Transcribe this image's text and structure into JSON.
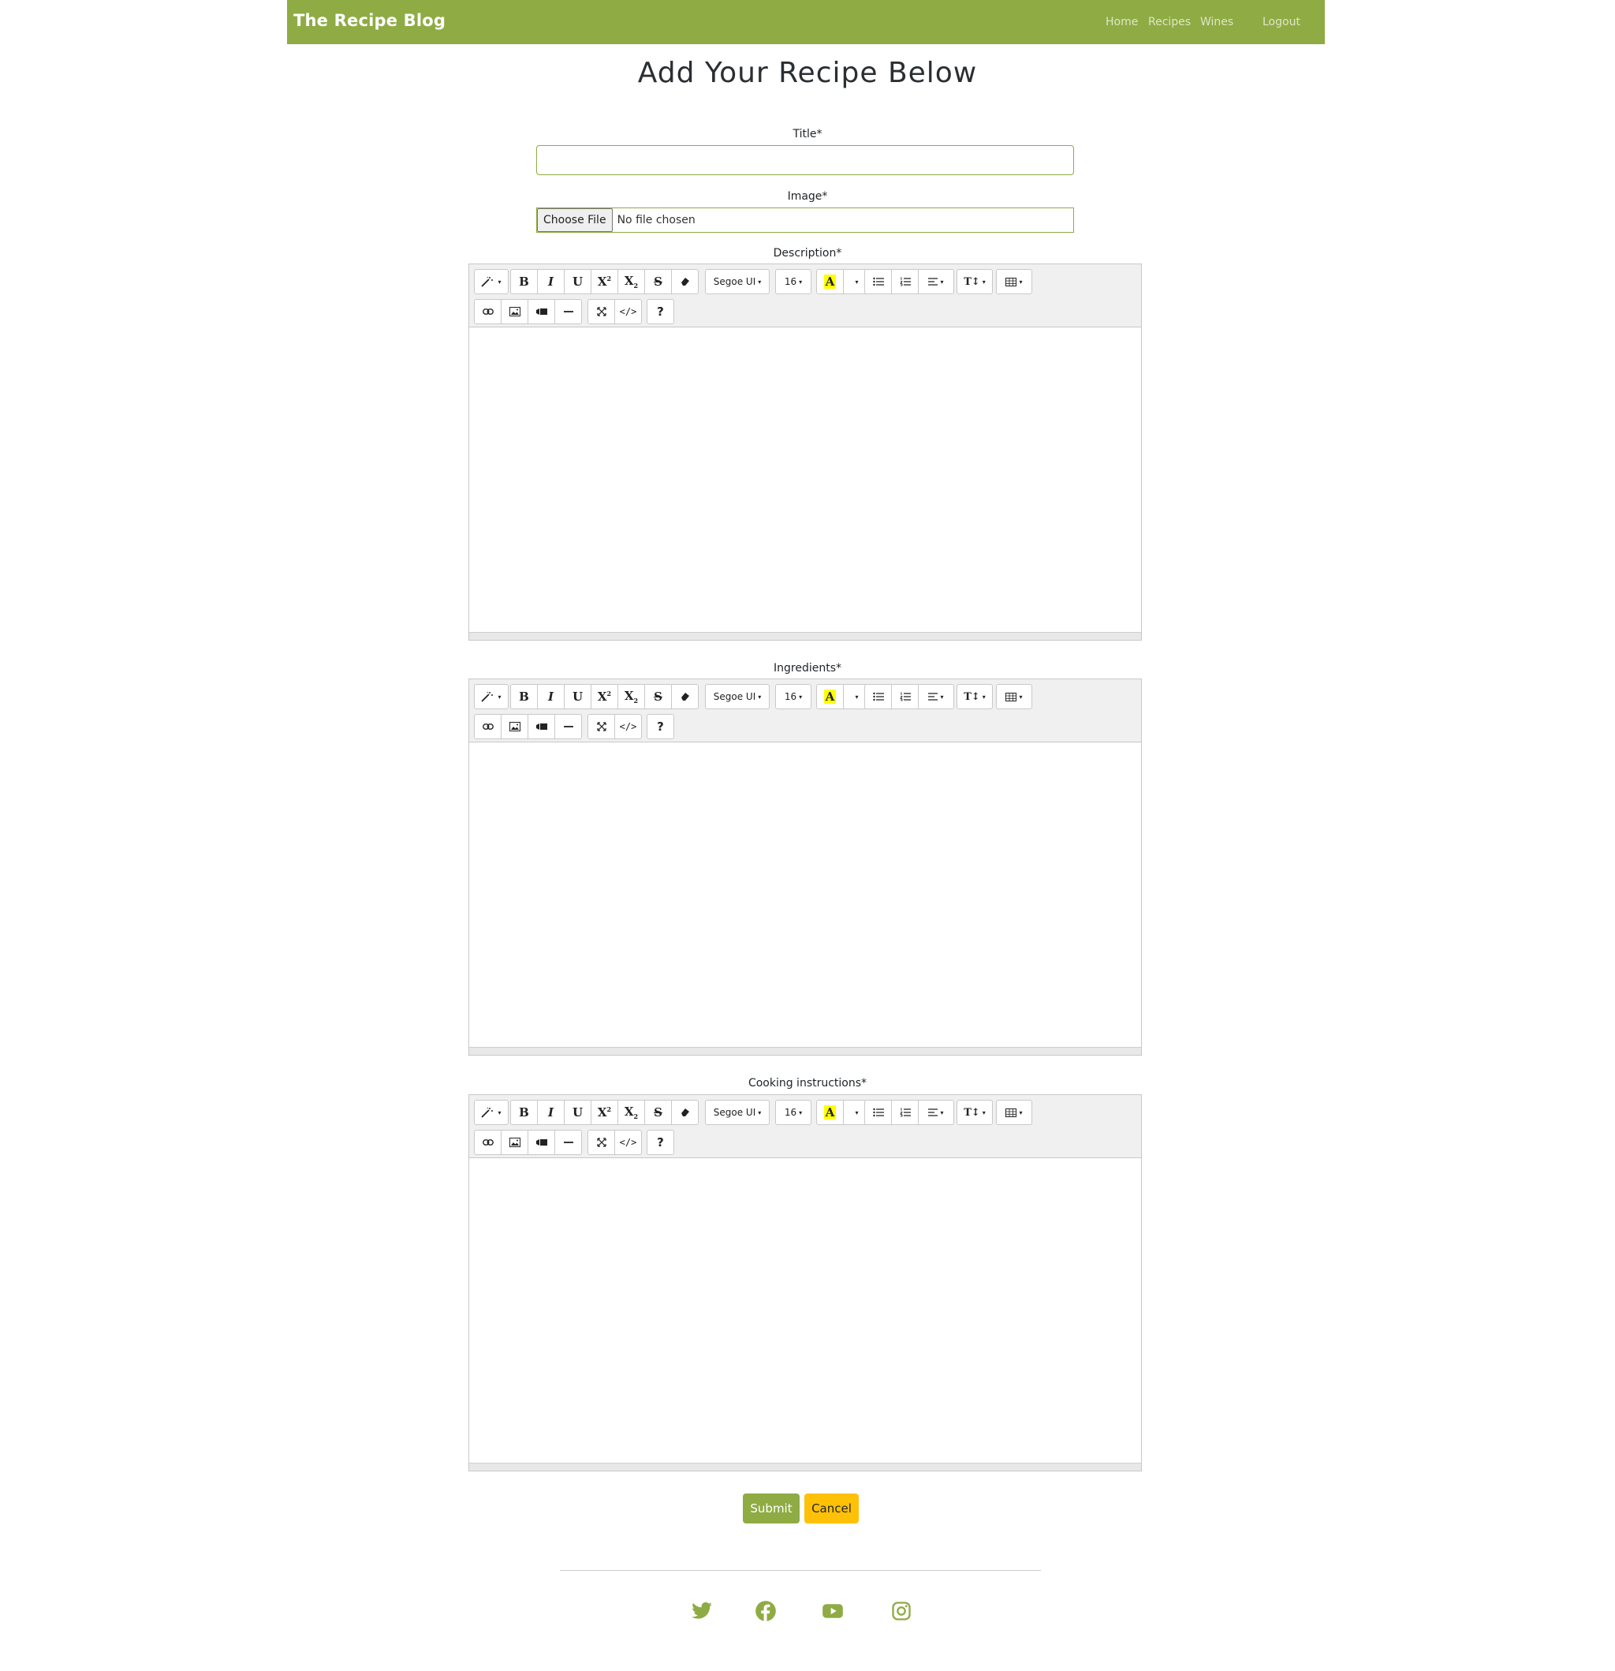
{
  "navbar": {
    "brand": "The Recipe Blog",
    "links": {
      "home": "Home",
      "recipes": "Recipes",
      "wines": "Wines",
      "logout": "Logout"
    },
    "color": "#8fab44"
  },
  "page": {
    "title": "Add Your Recipe Below"
  },
  "form": {
    "title_label": "Title*",
    "title_value": "",
    "image_label": "Image*",
    "file_button": "Choose File",
    "file_status": "No file chosen",
    "description_label": "Description*",
    "ingredients_label": "Ingredients*",
    "instructions_label": "Cooking instructions*"
  },
  "toolbar": {
    "font_name": "Segoe UI",
    "font_size": "16",
    "buttons_row1": [
      "magic-wand",
      "bold",
      "italic",
      "underline",
      "superscript",
      "subscript",
      "strikethrough",
      "eraser",
      "font-family",
      "font-size",
      "highlight-color",
      "color-dropdown",
      "unordered-list",
      "ordered-list",
      "paragraph-align",
      "line-height",
      "table"
    ],
    "buttons_row2": [
      "link",
      "picture",
      "video",
      "horizontal-rule",
      "fullscreen",
      "code-view",
      "help"
    ],
    "glyphs": {
      "bold": "B",
      "italic": "I",
      "underline": "U",
      "superscript": "X",
      "subscript": "X",
      "highlight": "A",
      "help": "?",
      "code": "</>"
    }
  },
  "actions": {
    "submit": "Submit",
    "cancel": "Cancel",
    "submit_color": "#8fab44",
    "cancel_color": "#ffc107"
  },
  "footer": {
    "icons": [
      "twitter-icon",
      "facebook-icon",
      "youtube-icon",
      "instagram-icon"
    ],
    "icon_color": "#8fab44"
  }
}
